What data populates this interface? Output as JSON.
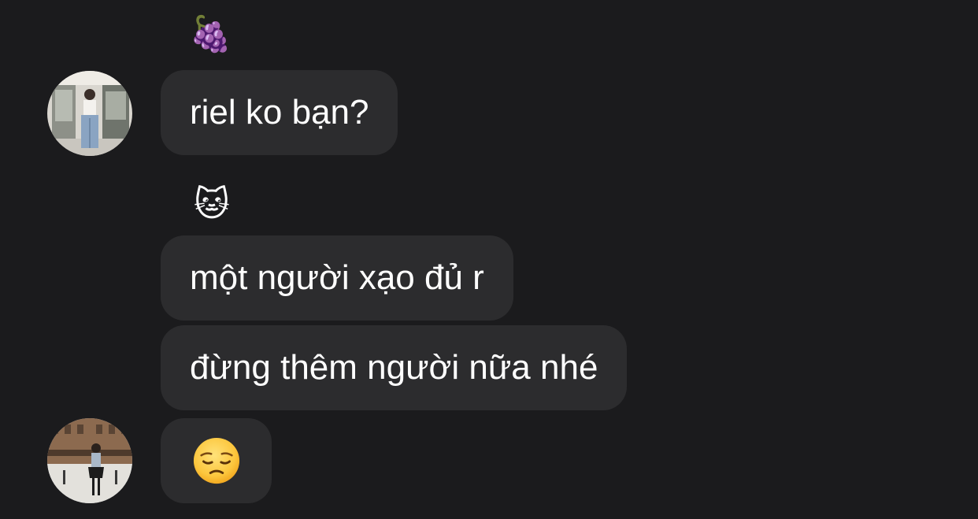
{
  "thread": {
    "messages": [
      {
        "text": "riel ko bạn?",
        "reaction": "🍇"
      },
      {
        "text": "một người xạo đủ r",
        "reaction": "🐱"
      },
      {
        "text": "đừng thêm người nữa nhé"
      },
      {
        "emoji": "pensive-face"
      }
    ],
    "avatars": [
      {
        "name": "sender-avatar-1"
      },
      {
        "name": "sender-avatar-2"
      }
    ]
  },
  "colors": {
    "background": "#1b1b1d",
    "bubble": "#2c2c2e",
    "text": "#ffffff"
  }
}
